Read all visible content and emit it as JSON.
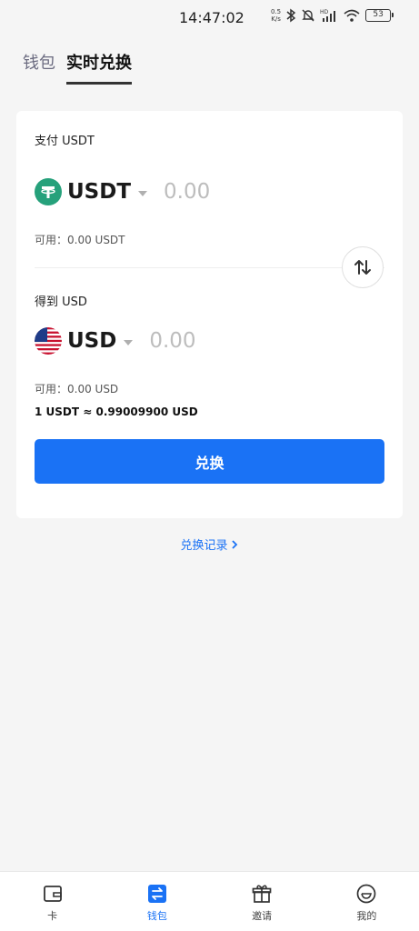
{
  "status_bar": {
    "time": "14:47:02",
    "net_speed_value": "0.5",
    "net_speed_unit": "K/s",
    "battery": "53"
  },
  "tabs": [
    {
      "label": "钱包",
      "active": false
    },
    {
      "label": "实时兑换",
      "active": true
    }
  ],
  "pay": {
    "label": "支付 USDT",
    "currency": "USDT",
    "amount_placeholder": "0.00",
    "available": "可用：0.00 USDT"
  },
  "receive": {
    "label": "得到 USD",
    "currency": "USD",
    "amount_placeholder": "0.00",
    "available": "可用：0.00 USD"
  },
  "rate": "1 USDT ≈ 0.99009900 USD",
  "exchange_button": "兑换",
  "history_link": "兑换记录",
  "bottom_nav": [
    {
      "label": "卡",
      "icon": "card-icon",
      "active": false
    },
    {
      "label": "钱包",
      "icon": "wallet-icon",
      "active": true
    },
    {
      "label": "邀请",
      "icon": "gift-icon",
      "active": false
    },
    {
      "label": "我的",
      "icon": "profile-icon",
      "active": false
    }
  ],
  "colors": {
    "accent": "#1a72f5",
    "usdt": "#26a17b"
  }
}
